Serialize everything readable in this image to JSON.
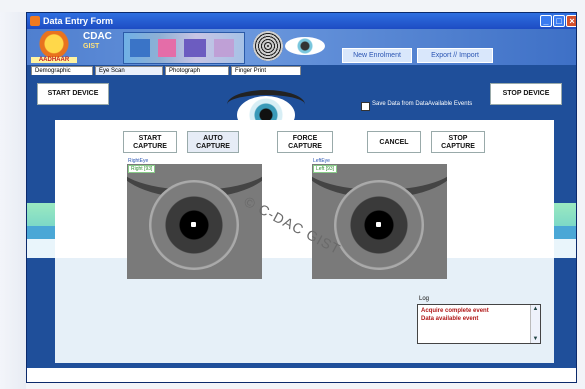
{
  "window": {
    "title": "Data Entry Form"
  },
  "banner": {
    "aadhaar_logo": "AADHAAR",
    "cdac_logo": "CDAC",
    "cdac_sub": "GIST",
    "new_enrolment": "New Enrolment",
    "export_import": "Export // Import"
  },
  "tabs": [
    "Demographic",
    "Eye Scan",
    "Photograph",
    "Finger Print"
  ],
  "device": {
    "start_label": "START DEVICE",
    "stop_label": "STOP DEVICE",
    "save_label": "Save Data from DataAvailable Events"
  },
  "capture": {
    "start": [
      "START",
      "CAPTURE"
    ],
    "auto": [
      "AUTO",
      "CAPTURE"
    ],
    "force": [
      "FORCE",
      "CAPTURE"
    ],
    "cancel": "CANCEL",
    "stop": [
      "STOP",
      "CAPTURE"
    ]
  },
  "eyes": {
    "right_label": "RightEye",
    "right_score": "Right [93]",
    "left_label": "LeftEye",
    "left_score": "Left [93]"
  },
  "watermark": "© C-DAC GIST",
  "log": {
    "label": "Log",
    "lines": [
      "Acquire complete event",
      "Data available event"
    ]
  },
  "colors": {
    "window_blue": "#1f4f9a",
    "title_blue": "#2f6fe0",
    "log_text_red": "#b01818"
  }
}
